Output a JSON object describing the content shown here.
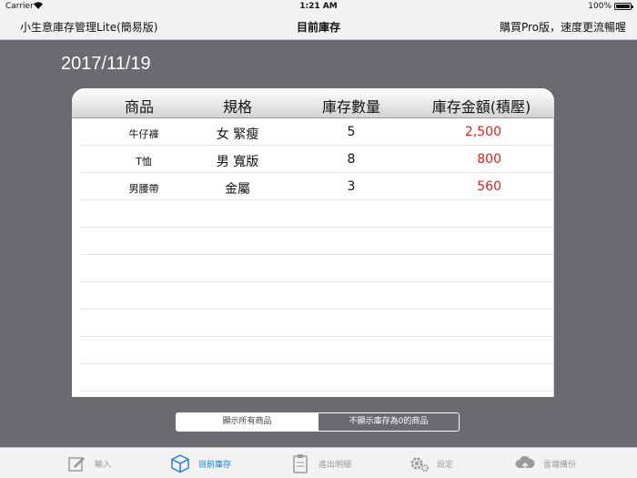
{
  "status": {
    "carrier": "Carrier",
    "time": "1:21 AM",
    "battery": "100%"
  },
  "nav": {
    "left": "小生意庫存管理Lite(簡易版)",
    "title": "目前庫存",
    "right": "購買Pro版，速度更流暢喔"
  },
  "date": "2017/11/19",
  "table": {
    "headers": [
      "商品",
      "規格",
      "庫存數量",
      "庫存金額(積壓)"
    ],
    "rows": [
      {
        "name": "牛仔褲",
        "spec": "女 緊瘦",
        "qty": "5",
        "value": "2,500"
      },
      {
        "name": "T恤",
        "spec": "男 寬版",
        "qty": "8",
        "value": "800"
      },
      {
        "name": "男腰帶",
        "spec": "金屬",
        "qty": "3",
        "value": "560"
      }
    ]
  },
  "segment": {
    "options": [
      "顯示所有商品",
      "不顯示庫存為0的商品"
    ]
  },
  "tabs": [
    {
      "label": "輸入",
      "icon": "edit-icon"
    },
    {
      "label": "目前庫存",
      "icon": "box-icon"
    },
    {
      "label": "進出明細",
      "icon": "clipboard-icon"
    },
    {
      "label": "設定",
      "icon": "gear-icon"
    },
    {
      "label": "雲端備份",
      "icon": "cloud-icon"
    }
  ],
  "colors": {
    "accent": "#1f7ee0",
    "value_red": "#e0201c",
    "background": "#6b6b6f"
  }
}
